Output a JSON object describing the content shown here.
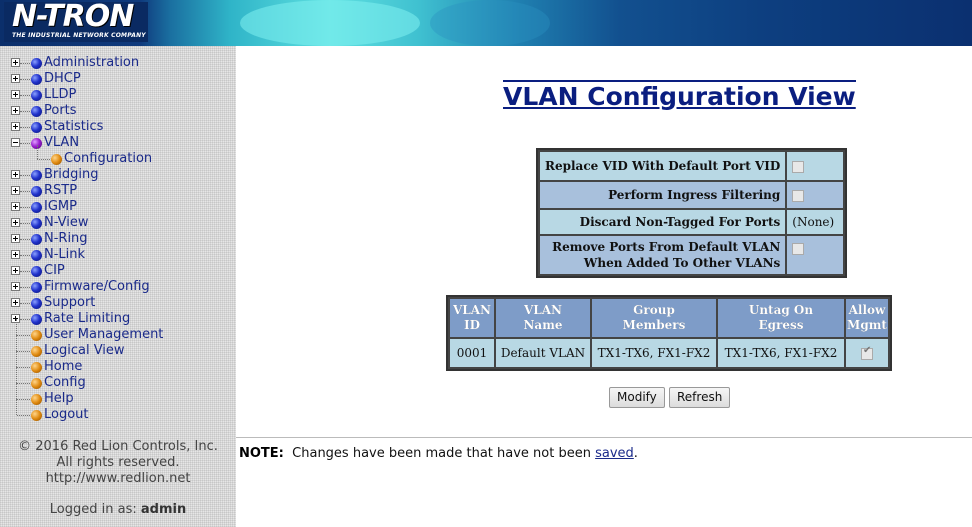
{
  "header": {
    "logo_text": "N-TRON",
    "logo_sub": "THE INDUSTRIAL NETWORK COMPANY"
  },
  "sidebar": {
    "items": [
      {
        "label": "Administration",
        "bullet": "blue",
        "expander": "plus"
      },
      {
        "label": "DHCP",
        "bullet": "blue",
        "expander": "plus"
      },
      {
        "label": "LLDP",
        "bullet": "blue",
        "expander": "plus"
      },
      {
        "label": "Ports",
        "bullet": "blue",
        "expander": "plus"
      },
      {
        "label": "Statistics",
        "bullet": "blue",
        "expander": "plus"
      },
      {
        "label": "VLAN",
        "bullet": "purple",
        "expander": "minus"
      },
      {
        "label": "Configuration",
        "bullet": "orange",
        "expander": "child"
      },
      {
        "label": "Bridging",
        "bullet": "blue",
        "expander": "plus"
      },
      {
        "label": "RSTP",
        "bullet": "blue",
        "expander": "plus"
      },
      {
        "label": "IGMP",
        "bullet": "blue",
        "expander": "plus"
      },
      {
        "label": "N-View",
        "bullet": "blue",
        "expander": "plus"
      },
      {
        "label": "N-Ring",
        "bullet": "blue",
        "expander": "plus"
      },
      {
        "label": "N-Link",
        "bullet": "blue",
        "expander": "plus"
      },
      {
        "label": "CIP",
        "bullet": "blue",
        "expander": "plus"
      },
      {
        "label": "Firmware/Config",
        "bullet": "blue",
        "expander": "plus"
      },
      {
        "label": "Support",
        "bullet": "blue",
        "expander": "plus"
      },
      {
        "label": "Rate Limiting",
        "bullet": "blue",
        "expander": "plus"
      },
      {
        "label": "User Management",
        "bullet": "orange",
        "expander": "none"
      },
      {
        "label": "Logical View",
        "bullet": "orange",
        "expander": "none"
      },
      {
        "label": "Home",
        "bullet": "orange",
        "expander": "none"
      },
      {
        "label": "Config",
        "bullet": "orange",
        "expander": "none"
      },
      {
        "label": "Help",
        "bullet": "orange",
        "expander": "none"
      },
      {
        "label": "Logout",
        "bullet": "orange",
        "expander": "none"
      }
    ],
    "copyright": [
      "© 2016 Red Lion Controls, Inc.",
      "All rights reserved.",
      "http://www.redlion.net"
    ],
    "logged_in_prefix": "Logged in as:",
    "logged_in_user": "admin"
  },
  "main": {
    "title": "VLAN Configuration View",
    "settings": [
      {
        "label": "Replace VID With Default Port VID",
        "type": "checkbox",
        "checked": false
      },
      {
        "label": "Perform Ingress Filtering",
        "type": "checkbox",
        "checked": false
      },
      {
        "label": "Discard Non-Tagged For Ports",
        "type": "text",
        "value": "(None)"
      },
      {
        "label_line1": "Remove Ports From Default VLAN",
        "label_line2": "When Added To Other VLANs",
        "type": "checkbox",
        "checked": false
      }
    ],
    "vlan_table": {
      "headers": [
        [
          "VLAN",
          "ID"
        ],
        [
          "VLAN",
          "Name"
        ],
        [
          "Group",
          "Members"
        ],
        [
          "Untag On",
          "Egress"
        ],
        [
          "Allow",
          "Mgmt"
        ]
      ],
      "rows": [
        {
          "id": "0001",
          "name": "Default VLAN",
          "members": "TX1-TX6, FX1-FX2",
          "untag": "TX1-TX6, FX1-FX2",
          "allow_mgmt": true
        }
      ]
    },
    "buttons": {
      "modify": "Modify",
      "refresh": "Refresh"
    },
    "note": {
      "label": "NOTE:",
      "text": "Changes have been made that have not been",
      "link": "saved",
      "end": "."
    }
  }
}
